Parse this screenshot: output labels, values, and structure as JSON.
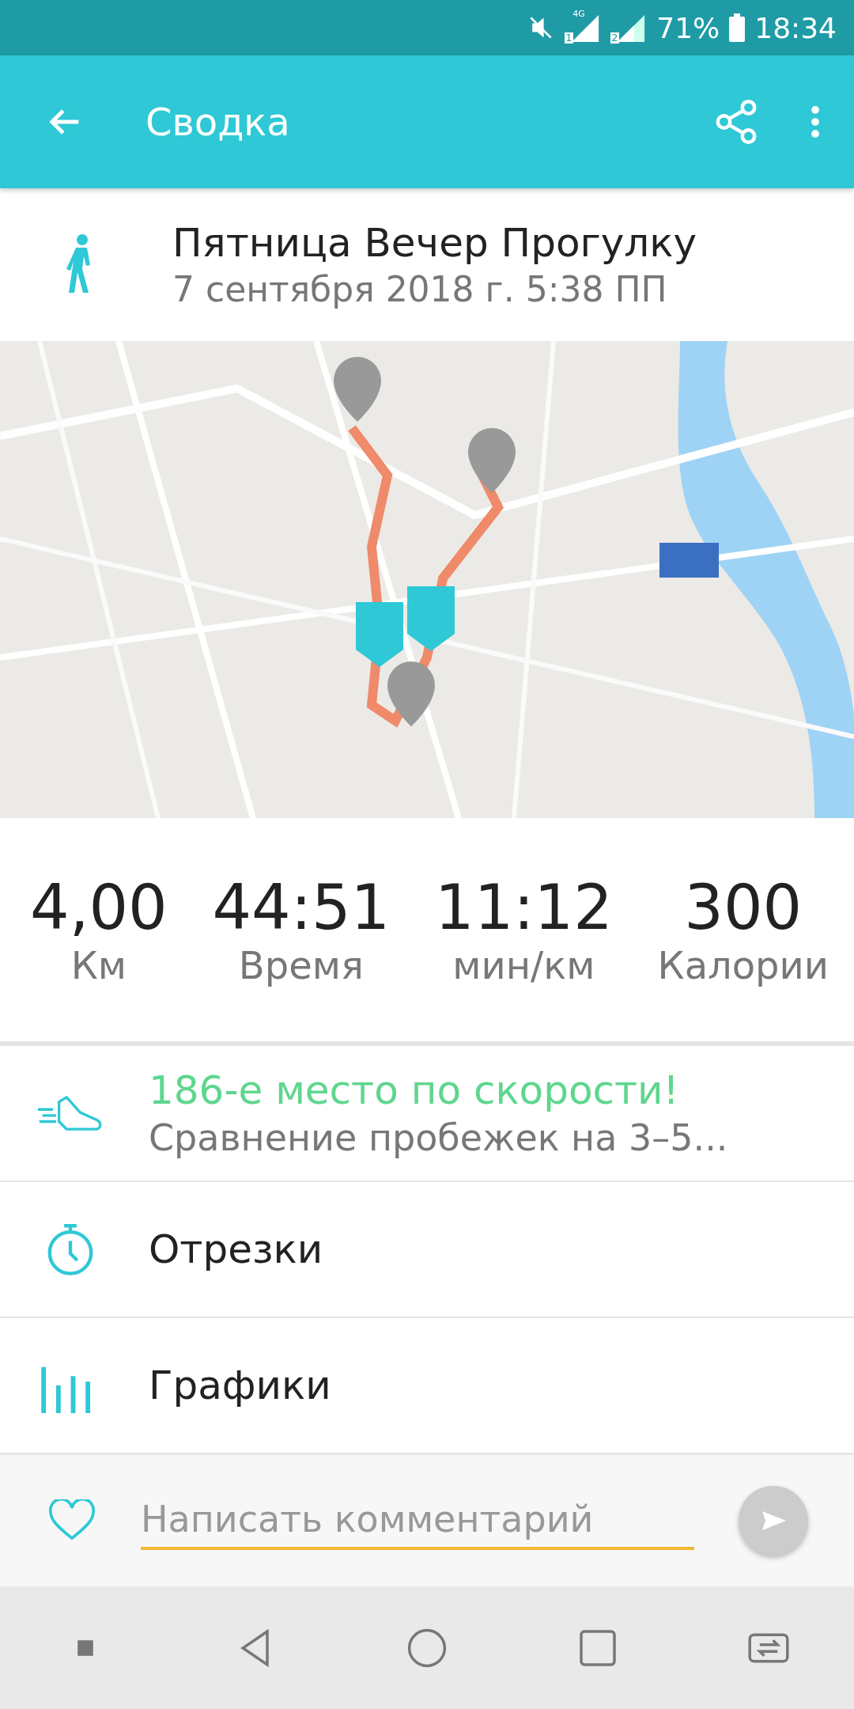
{
  "status_bar": {
    "network": "4G",
    "sim_labels": [
      "1",
      "2"
    ],
    "battery": "71%",
    "time": "18:34"
  },
  "app_bar": {
    "title": "Сводка"
  },
  "activity": {
    "title": "Пятница Вечер Прогулку",
    "date": "7 сентября 2018 г. 5:38 ПП"
  },
  "stats": [
    {
      "value": "4,00",
      "label": "Км"
    },
    {
      "value": "44:51",
      "label": "Время"
    },
    {
      "value": "11:12",
      "label": "мин/км"
    },
    {
      "value": "300",
      "label": "Калории"
    }
  ],
  "rows": [
    {
      "kind": "rank",
      "title": "186-е место по скорости!",
      "subtitle": "Сравнение пробежек на 3–5..."
    },
    {
      "kind": "splits",
      "title": "Отрезки"
    },
    {
      "kind": "charts",
      "title": "Графики"
    }
  ],
  "comment": {
    "placeholder": "Написать комментарий"
  }
}
